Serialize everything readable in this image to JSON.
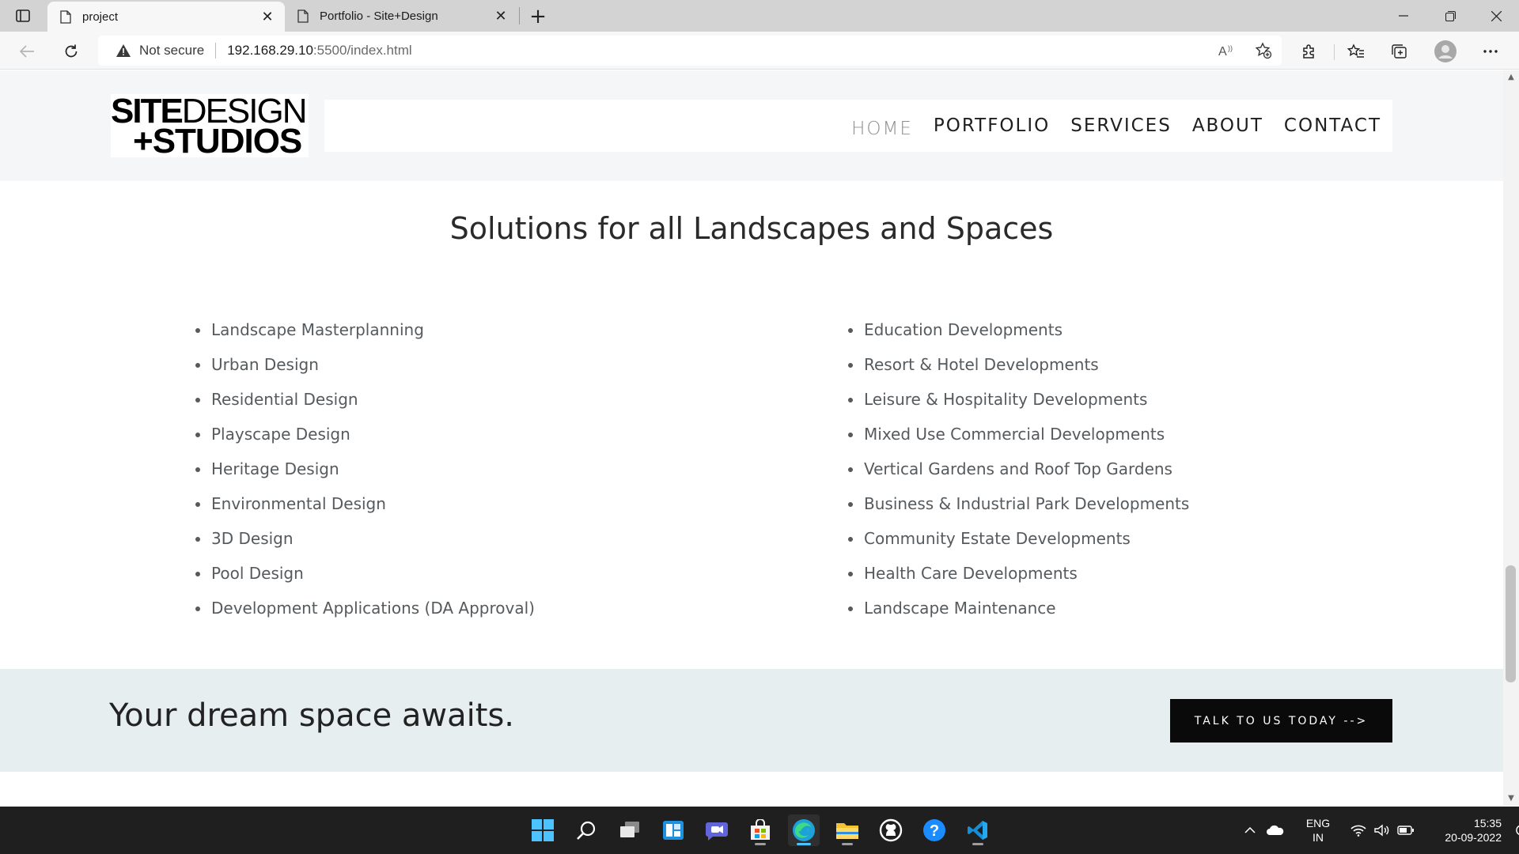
{
  "browser": {
    "tabs": [
      {
        "title": "project",
        "active": true
      },
      {
        "title": "Portfolio - Site+Design",
        "active": false
      }
    ],
    "address": {
      "security_label": "Not secure",
      "host": "192.168.29.10",
      "path": ":5500/index.html"
    }
  },
  "site": {
    "logo": {
      "line1_bold": "SITE",
      "line1_light": "DESIGN",
      "line2": "+STUDIOS"
    },
    "nav": [
      "HOME",
      "PORTFOLIO",
      "SERVICES",
      "ABOUT",
      "CONTACT"
    ],
    "nav_active": "HOME",
    "solutions_title": "Solutions for all Landscapes and Spaces",
    "services_left": [
      "Landscape Masterplanning",
      "Urban Design",
      "Residential Design",
      "Playscape Design",
      "Heritage Design",
      "Environmental Design",
      "3D Design",
      "Pool Design",
      "Development Applications (DA Approval)"
    ],
    "services_right": [
      "Education Developments",
      "Resort & Hotel Developments",
      "Leisure & Hospitality Developments",
      "Mixed Use Commercial Developments",
      "Vertical Gardens and Roof Top Gardens",
      "Business & Industrial Park Developments",
      "Community Estate Developments",
      "Health Care Developments",
      "Landscape Maintenance"
    ],
    "cta": {
      "text": "Your dream space awaits.",
      "button": "TALK TO US TODAY -->"
    }
  },
  "taskbar": {
    "apps": [
      "start-icon",
      "search-icon",
      "task-view-icon",
      "widgets-icon",
      "teams-chat-icon",
      "store-icon",
      "edge-icon",
      "file-explorer-icon",
      "github-icon",
      "help-icon",
      "vscode-icon"
    ],
    "language": {
      "line1": "ENG",
      "line2": "IN"
    },
    "clock": {
      "time": "15:35",
      "date": "20-09-2022"
    }
  },
  "colors": {
    "tabstrip": "#d3d3d3",
    "header_bg": "#f5f6f8",
    "cta_band": "#e6eef0",
    "cta_button": "#0a0a0a",
    "taskbar": "#1f1f1f"
  }
}
